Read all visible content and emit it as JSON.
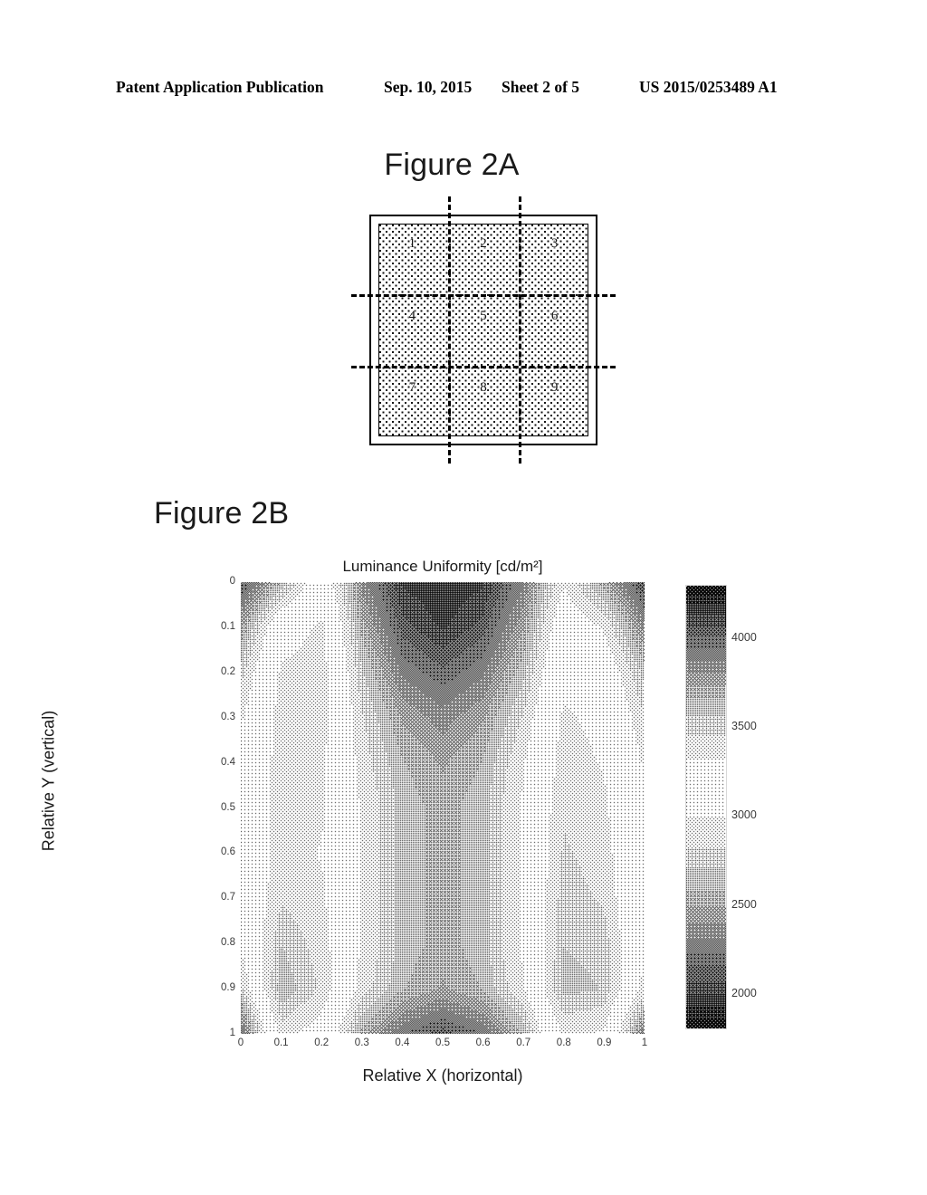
{
  "header": {
    "publication": "Patent Application Publication",
    "date": "Sep. 10, 2015",
    "sheet": "Sheet 2 of 5",
    "number": "US 2015/0253489 A1"
  },
  "figure_2a": {
    "title": "Figure 2A",
    "cells": [
      "1",
      "2",
      "3",
      "4",
      "5",
      "6",
      "7",
      "8",
      "9"
    ],
    "grid_rows": 3,
    "grid_cols": 3,
    "description": "Nine-zone measurement grid on a rectangular panel with dashed centerline guides"
  },
  "figure_2b": {
    "title": "Figure 2B"
  },
  "chart_data": {
    "type": "heatmap",
    "title": "Luminance Uniformity [cd/m²]",
    "xlabel": "Relative X (horizontal)",
    "ylabel": "Relative Y (vertical)",
    "xlim": [
      0,
      1
    ],
    "ylim": [
      0,
      1
    ],
    "y_axis_inverted": true,
    "grid": false,
    "colormap": "grayscale-converted-jet",
    "colorbar": {
      "position": "right",
      "ticks": [
        2000,
        2500,
        3000,
        3500,
        4000
      ],
      "tick_labels": [
        "2000",
        "2500",
        "3000",
        "3500",
        "4000"
      ],
      "vmin": 1800,
      "vmax": 4300
    },
    "xticks": [
      0,
      0.1,
      0.2,
      0.3,
      0.4,
      0.5,
      0.6,
      0.7,
      0.8,
      0.9,
      1
    ],
    "xtick_labels": [
      "0",
      "0.1",
      "0.2",
      "0.3",
      "0.4",
      "0.5",
      "0.6",
      "0.7",
      "0.8",
      "0.9",
      "1"
    ],
    "yticks": [
      0,
      0.1,
      0.2,
      0.3,
      0.4,
      0.5,
      0.6,
      0.7,
      0.8,
      0.9,
      1
    ],
    "ytick_labels": [
      "0",
      "0.1",
      "0.2",
      "0.3",
      "0.4",
      "0.5",
      "0.6",
      "0.7",
      "0.8",
      "0.9",
      "1"
    ],
    "x": [
      0,
      0.1,
      0.2,
      0.3,
      0.4,
      0.5,
      0.6,
      0.7,
      0.8,
      0.9,
      1
    ],
    "y": [
      0,
      0.1,
      0.2,
      0.3,
      0.4,
      0.5,
      0.6,
      0.7,
      0.8,
      0.9,
      1
    ],
    "z": [
      [
        4050,
        3650,
        3150,
        3850,
        4150,
        4200,
        4150,
        3900,
        3350,
        3700,
        4100
      ],
      [
        3750,
        3100,
        2950,
        3700,
        4050,
        4150,
        4050,
        3750,
        3150,
        3350,
        3850
      ],
      [
        3500,
        2950,
        2900,
        3550,
        3900,
        4000,
        3900,
        3600,
        3050,
        3150,
        3600
      ],
      [
        3350,
        2900,
        2900,
        3450,
        3750,
        3850,
        3750,
        3450,
        2950,
        3050,
        3450
      ],
      [
        3250,
        2900,
        2950,
        3400,
        3650,
        3750,
        3650,
        3350,
        2900,
        3000,
        3350
      ],
      [
        3200,
        2900,
        2950,
        3350,
        3600,
        3700,
        3600,
        3300,
        2850,
        2950,
        3300
      ],
      [
        3200,
        2900,
        3000,
        3350,
        3600,
        3700,
        3600,
        3300,
        2800,
        2900,
        3300
      ],
      [
        3250,
        2850,
        2950,
        3350,
        3600,
        3700,
        3600,
        3300,
        2750,
        2850,
        3300
      ],
      [
        3300,
        2700,
        2900,
        3350,
        3600,
        3700,
        3600,
        3300,
        2700,
        2750,
        3300
      ],
      [
        3500,
        2600,
        2850,
        3400,
        3650,
        3750,
        3650,
        3350,
        2650,
        2700,
        3400
      ],
      [
        4000,
        2900,
        3100,
        3700,
        3950,
        4050,
        3950,
        3650,
        2950,
        3000,
        3900
      ]
    ],
    "notes": "Dark regions correspond to both the highest (~4000+) and lowest (~2000) luminance because the original color map was converted to grayscale; mid-range values (~3000-3200) render lightest."
  }
}
